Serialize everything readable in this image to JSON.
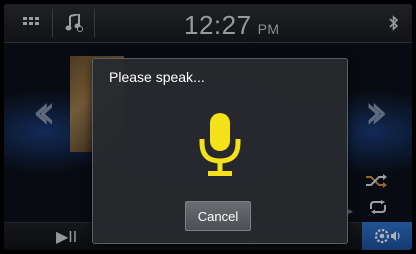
{
  "status_bar": {
    "time": "12:27",
    "ampm": "PM",
    "icons": [
      "grid-menu-icon",
      "music-note-icon",
      "bluetooth-icon"
    ]
  },
  "dialog": {
    "title": "Please speak...",
    "icon": "microphone-icon",
    "cancel_label": "Cancel"
  },
  "controls": {
    "icons": [
      "previous-chevron-icon",
      "next-chevron-icon",
      "shuffle-icon",
      "repeat-icon",
      "play-pause-icon",
      "audio-settings-icon"
    ],
    "play_pause_glyph": "▶II"
  },
  "colors": {
    "mic_yellow": "#f4e11a",
    "accent_blue": "#2e6fc4",
    "dialog_bg": "#28292e"
  }
}
